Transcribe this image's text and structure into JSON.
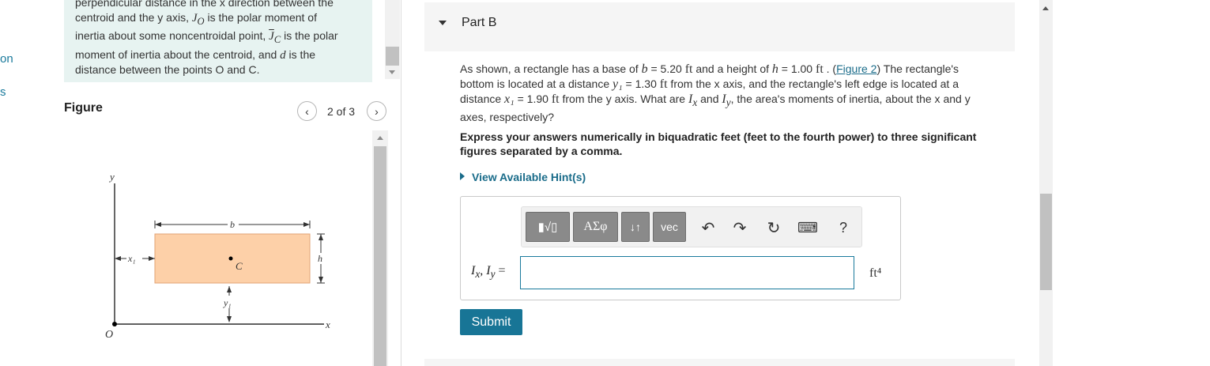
{
  "left_edge": {
    "item1": "on",
    "item2": "s"
  },
  "note": {
    "line1": "perpendicular distance in the x direction between the",
    "line2_pre": "centroid and the y axis, ",
    "line2_sym": "J_O",
    "line2_post": " is the polar moment of",
    "line3_pre": "inertia about some noncentroidal point, ",
    "line3_sym": "J̄_C",
    "line3_post": " is the polar",
    "line4_pre": "moment of inertia about the centroid, and ",
    "line4_sym": "d",
    "line4_post": " is the",
    "line5": "distance between the points O and C."
  },
  "figure": {
    "title": "Figure",
    "pager": "2 of 3",
    "prev_icon": "chevron-left-icon",
    "next_icon": "chevron-right-icon",
    "labels": {
      "y": "y",
      "b": "b",
      "h": "h",
      "x1": "x₁",
      "y1": "y₁",
      "c": "C",
      "o": "O",
      "x": "x"
    },
    "colors": {
      "rect_fill": "#fdd0a8",
      "rect_stroke": "#e2a374"
    }
  },
  "part_b": {
    "title": "Part B",
    "q_line1_a": "As shown, a rectangle has a base of ",
    "q_b_sym": "b",
    "q_b_val": " = 5.20 ",
    "q_ft": "ft",
    "q_line1_b": " and a height of ",
    "q_h_sym": "h",
    "q_h_val": " = 1.00 ",
    "q_line1_c": " . (",
    "q_link": "Figure 2",
    "q_line1_d": ") The rectangle's",
    "q_line2_a": "bottom is located at a distance ",
    "q_y1_sym": "y₁",
    "q_y1_val": " = 1.30 ",
    "q_line2_b": " from the x axis, and the rectangle's left edge is located at a",
    "q_line3_a": "distance ",
    "q_x1_sym": "x₁",
    "q_x1_val": " = 1.90 ",
    "q_line3_b": " from the y axis. What are ",
    "q_ix": "Iₓ",
    "q_line3_c": " and ",
    "q_iy": "I_y",
    "q_line3_d": ", the area's moments of inertia, about the x and y",
    "q_line4": "axes, respectively?",
    "instruction": "Express your answers numerically in biquadratic feet (feet to the fourth power) to three significant figures separated by a comma.",
    "hints": "View Available Hint(s)",
    "toolbar": {
      "templates": "▮√▯",
      "greek": "ΑΣφ",
      "arrows": "↓↑",
      "vec": "vec",
      "undo_icon": "undo-icon",
      "redo_icon": "redo-icon",
      "reset_icon": "reset-icon",
      "keyboard_icon": "keyboard-icon",
      "help": "?"
    },
    "answer_label": "Iₓ, I_y =",
    "answer_value": "",
    "answer_unit": "ft⁴",
    "submit": "Submit"
  }
}
